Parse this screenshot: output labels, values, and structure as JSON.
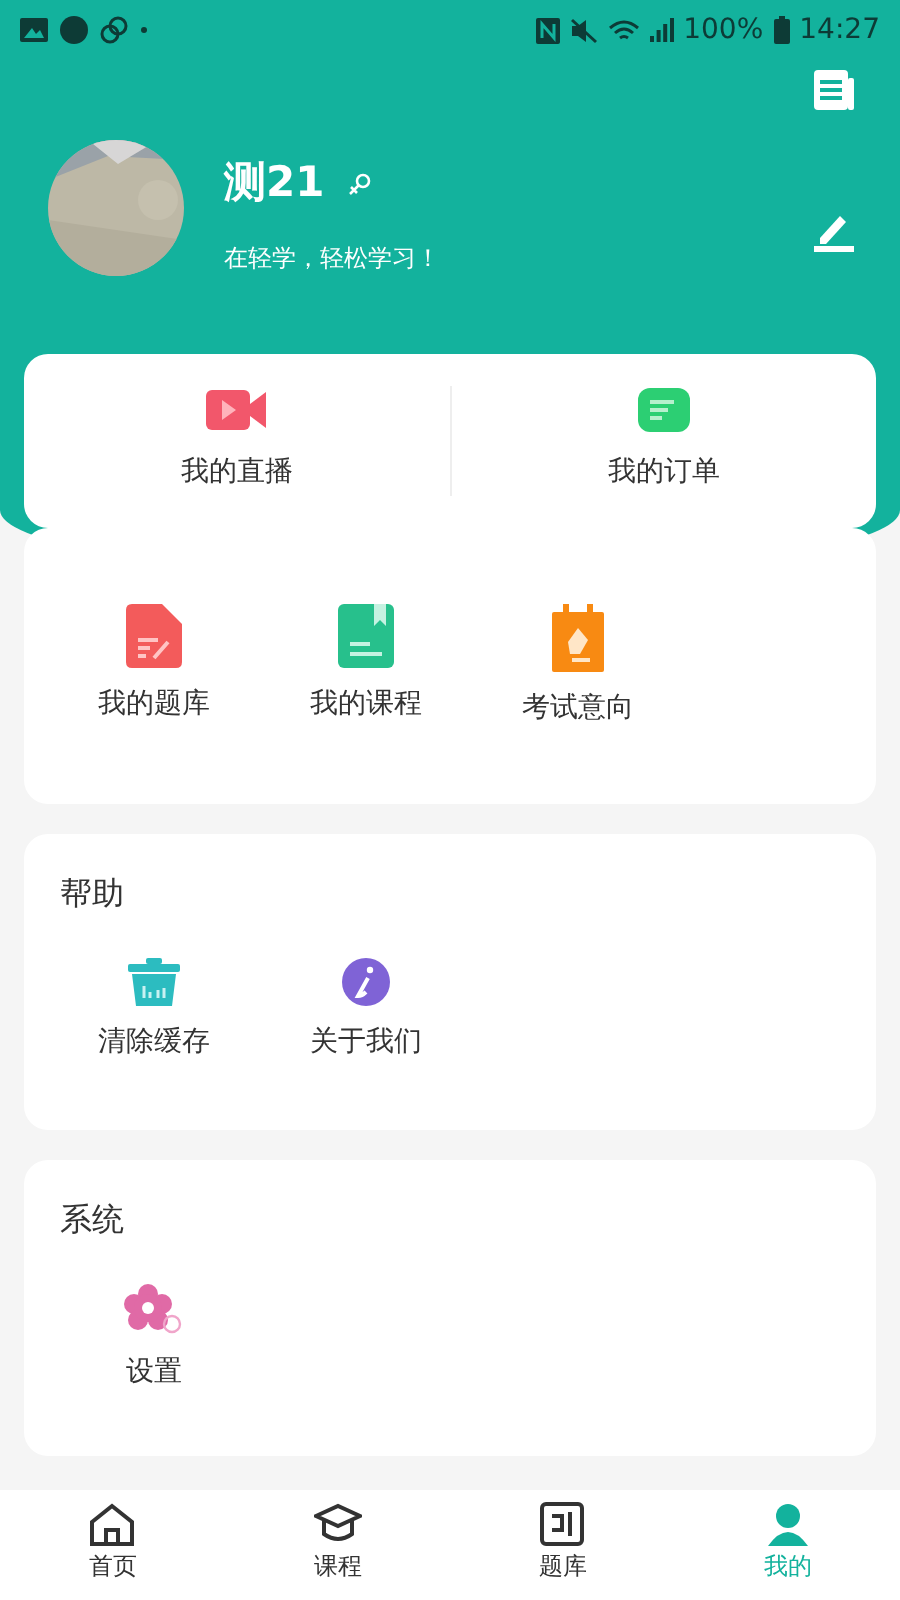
{
  "status_bar": {
    "battery": "100%",
    "time": "14:27"
  },
  "profile": {
    "name": "测21",
    "motto": "在轻学，轻松学习！"
  },
  "quick_links": [
    {
      "label": "我的直播",
      "kind": "live"
    },
    {
      "label": "我的订单",
      "kind": "order"
    }
  ],
  "my_items": [
    {
      "label": "我的题库",
      "kind": "bank"
    },
    {
      "label": "我的课程",
      "kind": "course"
    },
    {
      "label": "考试意向",
      "kind": "exam"
    }
  ],
  "help": {
    "title": "帮助",
    "items": [
      {
        "label": "清除缓存",
        "kind": "clear"
      },
      {
        "label": "关于我们",
        "kind": "about"
      }
    ]
  },
  "system": {
    "title": "系统",
    "items": [
      {
        "label": "设置",
        "kind": "settings"
      }
    ]
  },
  "tabs": [
    {
      "label": "首页",
      "kind": "home",
      "selected": false
    },
    {
      "label": "课程",
      "kind": "course",
      "selected": false
    },
    {
      "label": "题库",
      "kind": "bank",
      "selected": false
    },
    {
      "label": "我的",
      "kind": "me",
      "selected": true
    }
  ]
}
